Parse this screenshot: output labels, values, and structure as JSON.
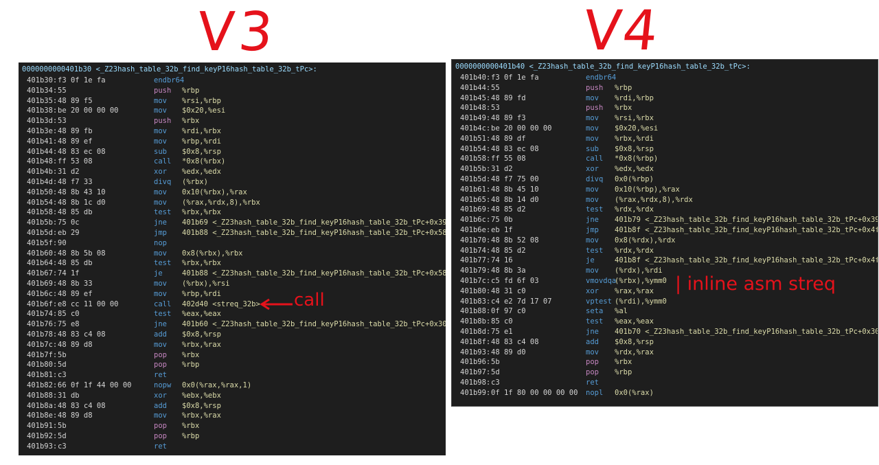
{
  "annotations": {
    "v3_label": "V3",
    "v4_label": "V4",
    "call_note": "call",
    "inline_note": "| inline asm streq"
  },
  "v3": {
    "header": "0000000000401b30 <_Z23hash_table_32b_find_keyP16hash_table_32b_tPc>:",
    "rows": [
      {
        "addr": "401b30:",
        "bytes": "f3 0f 1e fa",
        "mn": "endbr64",
        "ops": ""
      },
      {
        "addr": "401b34:",
        "bytes": "55",
        "mn": "push",
        "ops": "%rbp"
      },
      {
        "addr": "401b35:",
        "bytes": "48 89 f5",
        "mn": "mov",
        "ops": "%rsi,%rbp"
      },
      {
        "addr": "401b38:",
        "bytes": "be 20 00 00 00",
        "mn": "mov",
        "ops": "$0x20,%esi"
      },
      {
        "addr": "401b3d:",
        "bytes": "53",
        "mn": "push",
        "ops": "%rbx"
      },
      {
        "addr": "401b3e:",
        "bytes": "48 89 fb",
        "mn": "mov",
        "ops": "%rdi,%rbx"
      },
      {
        "addr": "401b41:",
        "bytes": "48 89 ef",
        "mn": "mov",
        "ops": "%rbp,%rdi"
      },
      {
        "addr": "401b44:",
        "bytes": "48 83 ec 08",
        "mn": "sub",
        "ops": "$0x8,%rsp"
      },
      {
        "addr": "401b48:",
        "bytes": "ff 53 08",
        "mn": "call",
        "ops": "*0x8(%rbx)"
      },
      {
        "addr": "401b4b:",
        "bytes": "31 d2",
        "mn": "xor",
        "ops": "%edx,%edx"
      },
      {
        "addr": "401b4d:",
        "bytes": "48 f7 33",
        "mn": "divq",
        "ops": "(%rbx)"
      },
      {
        "addr": "401b50:",
        "bytes": "48 8b 43 10",
        "mn": "mov",
        "ops": "0x10(%rbx),%rax"
      },
      {
        "addr": "401b54:",
        "bytes": "48 8b 1c d0",
        "mn": "mov",
        "ops": "(%rax,%rdx,8),%rbx"
      },
      {
        "addr": "401b58:",
        "bytes": "48 85 db",
        "mn": "test",
        "ops": "%rbx,%rbx"
      },
      {
        "addr": "401b5b:",
        "bytes": "75 0c",
        "mn": "jne",
        "ops": "401b69 <_Z23hash_table_32b_find_keyP16hash_table_32b_tPc+0x39>"
      },
      {
        "addr": "401b5d:",
        "bytes": "eb 29",
        "mn": "jmp",
        "ops": "401b88 <_Z23hash_table_32b_find_keyP16hash_table_32b_tPc+0x58>"
      },
      {
        "addr": "401b5f:",
        "bytes": "90",
        "mn": "nop",
        "ops": ""
      },
      {
        "addr": "401b60:",
        "bytes": "48 8b 5b 08",
        "mn": "mov",
        "ops": "0x8(%rbx),%rbx"
      },
      {
        "addr": "401b64:",
        "bytes": "48 85 db",
        "mn": "test",
        "ops": "%rbx,%rbx"
      },
      {
        "addr": "401b67:",
        "bytes": "74 1f",
        "mn": "je",
        "ops": "401b88 <_Z23hash_table_32b_find_keyP16hash_table_32b_tPc+0x58>"
      },
      {
        "addr": "401b69:",
        "bytes": "48 8b 33",
        "mn": "mov",
        "ops": "(%rbx),%rsi"
      },
      {
        "addr": "401b6c:",
        "bytes": "48 89 ef",
        "mn": "mov",
        "ops": "%rbp,%rdi"
      },
      {
        "addr": "401b6f:",
        "bytes": "e8 cc 11 00 00",
        "mn": "call",
        "ops": "402d40 <streq_32b>"
      },
      {
        "addr": "401b74:",
        "bytes": "85 c0",
        "mn": "test",
        "ops": "%eax,%eax"
      },
      {
        "addr": "401b76:",
        "bytes": "75 e8",
        "mn": "jne",
        "ops": "401b60 <_Z23hash_table_32b_find_keyP16hash_table_32b_tPc+0x30>"
      },
      {
        "addr": "401b78:",
        "bytes": "48 83 c4 08",
        "mn": "add",
        "ops": "$0x8,%rsp"
      },
      {
        "addr": "401b7c:",
        "bytes": "48 89 d8",
        "mn": "mov",
        "ops": "%rbx,%rax"
      },
      {
        "addr": "401b7f:",
        "bytes": "5b",
        "mn": "pop",
        "ops": "%rbx"
      },
      {
        "addr": "401b80:",
        "bytes": "5d",
        "mn": "pop",
        "ops": "%rbp"
      },
      {
        "addr": "401b81:",
        "bytes": "c3",
        "mn": "ret",
        "ops": ""
      },
      {
        "addr": "401b82:",
        "bytes": "66 0f 1f 44 00 00",
        "mn": "nopw",
        "ops": "0x0(%rax,%rax,1)"
      },
      {
        "addr": "401b88:",
        "bytes": "31 db",
        "mn": "xor",
        "ops": "%ebx,%ebx"
      },
      {
        "addr": "401b8a:",
        "bytes": "48 83 c4 08",
        "mn": "add",
        "ops": "$0x8,%rsp"
      },
      {
        "addr": "401b8e:",
        "bytes": "48 89 d8",
        "mn": "mov",
        "ops": "%rbx,%rax"
      },
      {
        "addr": "401b91:",
        "bytes": "5b",
        "mn": "pop",
        "ops": "%rbx"
      },
      {
        "addr": "401b92:",
        "bytes": "5d",
        "mn": "pop",
        "ops": "%rbp"
      },
      {
        "addr": "401b93:",
        "bytes": "c3",
        "mn": "ret",
        "ops": ""
      }
    ]
  },
  "v4": {
    "header": "0000000000401b40 <_Z23hash_table_32b_find_keyP16hash_table_32b_tPc>:",
    "rows": [
      {
        "addr": "401b40:",
        "bytes": "f3 0f 1e fa",
        "mn": "endbr64",
        "ops": ""
      },
      {
        "addr": "401b44:",
        "bytes": "55",
        "mn": "push",
        "ops": "%rbp"
      },
      {
        "addr": "401b45:",
        "bytes": "48 89 fd",
        "mn": "mov",
        "ops": "%rdi,%rbp"
      },
      {
        "addr": "401b48:",
        "bytes": "53",
        "mn": "push",
        "ops": "%rbx"
      },
      {
        "addr": "401b49:",
        "bytes": "48 89 f3",
        "mn": "mov",
        "ops": "%rsi,%rbx"
      },
      {
        "addr": "401b4c:",
        "bytes": "be 20 00 00 00",
        "mn": "mov",
        "ops": "$0x20,%esi"
      },
      {
        "addr": "401b51:",
        "bytes": "48 89 df",
        "mn": "mov",
        "ops": "%rbx,%rdi"
      },
      {
        "addr": "401b54:",
        "bytes": "48 83 ec 08",
        "mn": "sub",
        "ops": "$0x8,%rsp"
      },
      {
        "addr": "401b58:",
        "bytes": "ff 55 08",
        "mn": "call",
        "ops": "*0x8(%rbp)"
      },
      {
        "addr": "401b5b:",
        "bytes": "31 d2",
        "mn": "xor",
        "ops": "%edx,%edx"
      },
      {
        "addr": "401b5d:",
        "bytes": "48 f7 75 00",
        "mn": "divq",
        "ops": "0x0(%rbp)"
      },
      {
        "addr": "401b61:",
        "bytes": "48 8b 45 10",
        "mn": "mov",
        "ops": "0x10(%rbp),%rax"
      },
      {
        "addr": "401b65:",
        "bytes": "48 8b 14 d0",
        "mn": "mov",
        "ops": "(%rax,%rdx,8),%rdx"
      },
      {
        "addr": "401b69:",
        "bytes": "48 85 d2",
        "mn": "test",
        "ops": "%rdx,%rdx"
      },
      {
        "addr": "401b6c:",
        "bytes": "75 0b",
        "mn": "jne",
        "ops": "401b79 <_Z23hash_table_32b_find_keyP16hash_table_32b_tPc+0x39>"
      },
      {
        "addr": "401b6e:",
        "bytes": "eb 1f",
        "mn": "jmp",
        "ops": "401b8f <_Z23hash_table_32b_find_keyP16hash_table_32b_tPc+0x4f>"
      },
      {
        "addr": "401b70:",
        "bytes": "48 8b 52 08",
        "mn": "mov",
        "ops": "0x8(%rdx),%rdx"
      },
      {
        "addr": "401b74:",
        "bytes": "48 85 d2",
        "mn": "test",
        "ops": "%rdx,%rdx"
      },
      {
        "addr": "401b77:",
        "bytes": "74 16",
        "mn": "je",
        "ops": "401b8f <_Z23hash_table_32b_find_keyP16hash_table_32b_tPc+0x4f>"
      },
      {
        "addr": "401b79:",
        "bytes": "48 8b 3a",
        "mn": "mov",
        "ops": "(%rdx),%rdi"
      },
      {
        "addr": "401b7c:",
        "bytes": "c5 fd 6f 03",
        "mn": "vmovdqa",
        "ops": "(%rbx),%ymm0"
      },
      {
        "addr": "401b80:",
        "bytes": "48 31 c0",
        "mn": "xor",
        "ops": "%rax,%rax"
      },
      {
        "addr": "401b83:",
        "bytes": "c4 e2 7d 17 07",
        "mn": "vptest",
        "ops": "(%rdi),%ymm0"
      },
      {
        "addr": "401b88:",
        "bytes": "0f 97 c0",
        "mn": "seta",
        "ops": "%al"
      },
      {
        "addr": "401b8b:",
        "bytes": "85 c0",
        "mn": "test",
        "ops": "%eax,%eax"
      },
      {
        "addr": "401b8d:",
        "bytes": "75 e1",
        "mn": "jne",
        "ops": "401b70 <_Z23hash_table_32b_find_keyP16hash_table_32b_tPc+0x30>"
      },
      {
        "addr": "401b8f:",
        "bytes": "48 83 c4 08",
        "mn": "add",
        "ops": "$0x8,%rsp"
      },
      {
        "addr": "401b93:",
        "bytes": "48 89 d0",
        "mn": "mov",
        "ops": "%rdx,%rax"
      },
      {
        "addr": "401b96:",
        "bytes": "5b",
        "mn": "pop",
        "ops": "%rbx"
      },
      {
        "addr": "401b97:",
        "bytes": "5d",
        "mn": "pop",
        "ops": "%rbp"
      },
      {
        "addr": "401b98:",
        "bytes": "c3",
        "mn": "ret",
        "ops": ""
      },
      {
        "addr": "401b99:",
        "bytes": "0f 1f 80 00 00 00 00",
        "mn": "nopl",
        "ops": "0x0(%rax)"
      }
    ]
  },
  "colors": {
    "panel_bg": "#1e1e1e",
    "mnemonic": "#569cd6",
    "push_pop": "#c586c0",
    "operands": "#dcdcaa",
    "annotation_red": "#e5121b"
  }
}
